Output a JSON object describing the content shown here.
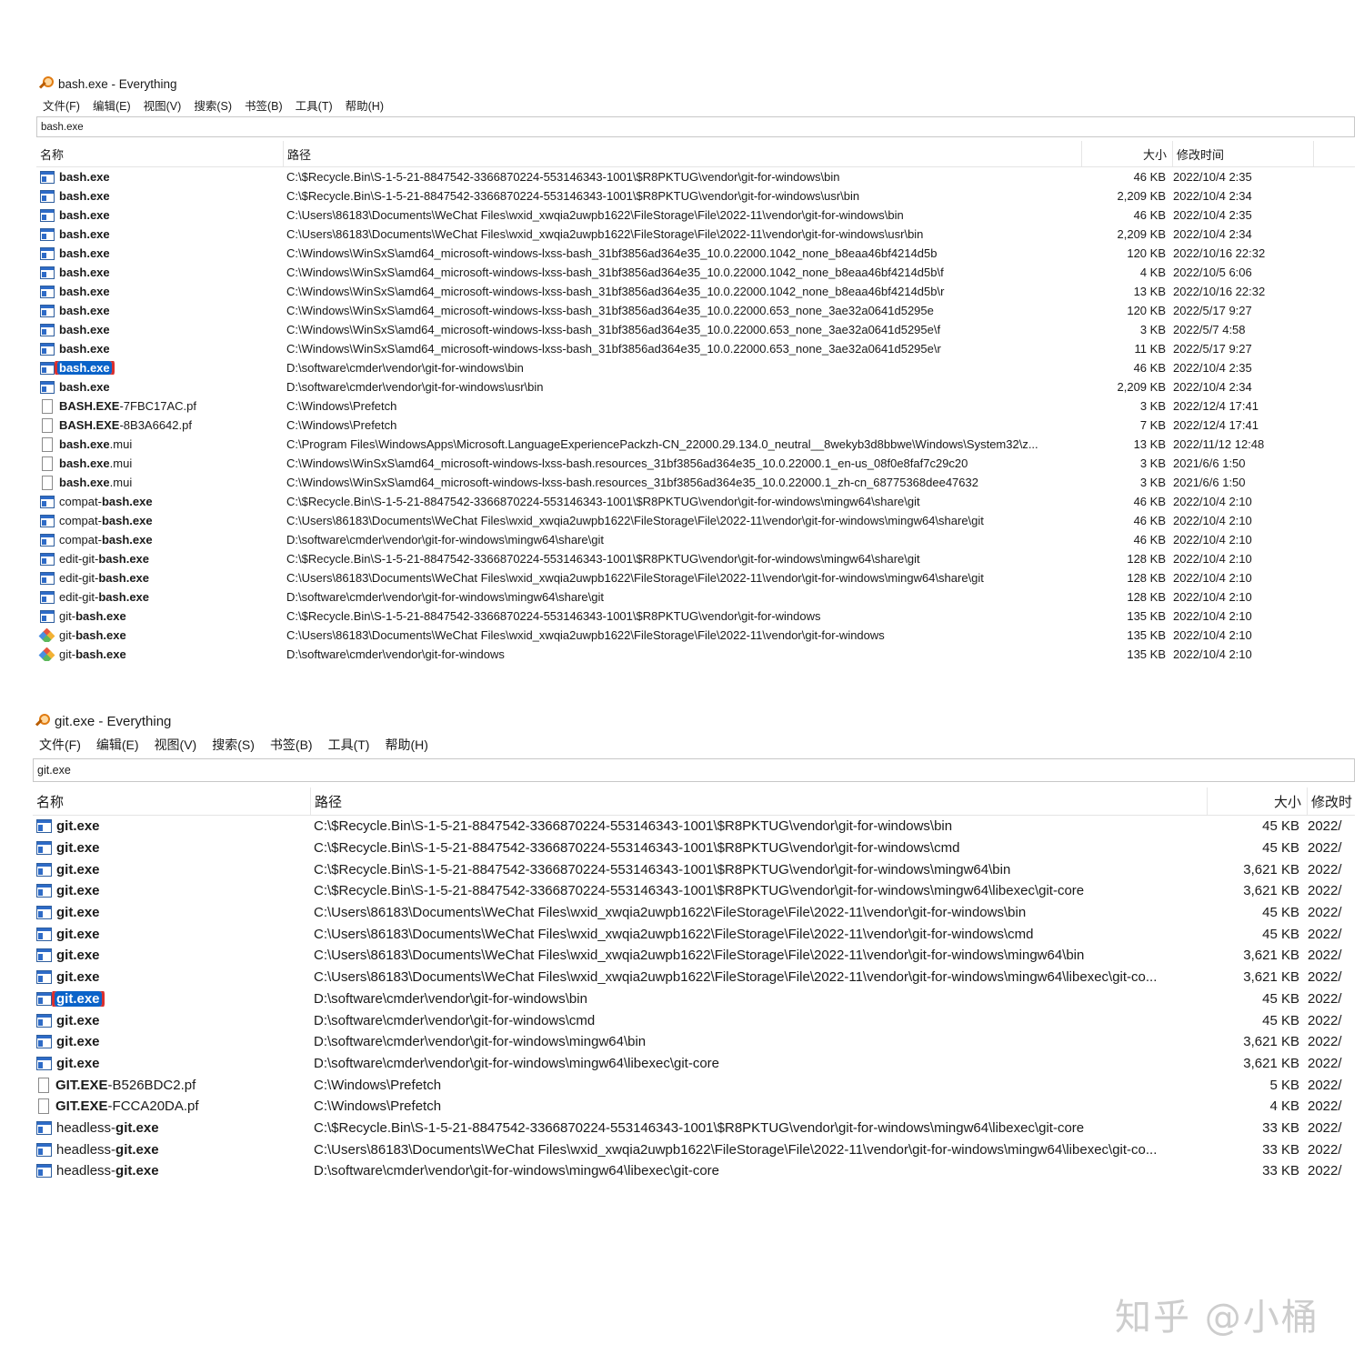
{
  "windows": [
    {
      "title": "bash.exe - Everything",
      "menu": [
        "文件(F)",
        "编辑(E)",
        "视图(V)",
        "搜索(S)",
        "书签(B)",
        "工具(T)",
        "帮助(H)"
      ],
      "search_value": "bash.exe",
      "columns": {
        "name": "名称",
        "path": "路径",
        "size": "大小",
        "modified": "修改时间"
      },
      "selected_index": 10,
      "rows": [
        {
          "icon": "exe-icon",
          "prefix": "",
          "match": "bash.exe",
          "suffix": "",
          "path": "C:\\$Recycle.Bin\\S-1-5-21-8847542-3366870224-553146343-1001\\$R8PKTUG\\vendor\\git-for-windows\\bin",
          "size": "46 KB",
          "modified": "2022/10/4 2:35"
        },
        {
          "icon": "exe-icon",
          "prefix": "",
          "match": "bash.exe",
          "suffix": "",
          "path": "C:\\$Recycle.Bin\\S-1-5-21-8847542-3366870224-553146343-1001\\$R8PKTUG\\vendor\\git-for-windows\\usr\\bin",
          "size": "2,209 KB",
          "modified": "2022/10/4 2:34"
        },
        {
          "icon": "exe-icon",
          "prefix": "",
          "match": "bash.exe",
          "suffix": "",
          "path": "C:\\Users\\86183\\Documents\\WeChat Files\\wxid_xwqia2uwpb1622\\FileStorage\\File\\2022-11\\vendor\\git-for-windows\\bin",
          "size": "46 KB",
          "modified": "2022/10/4 2:35"
        },
        {
          "icon": "exe-icon",
          "prefix": "",
          "match": "bash.exe",
          "suffix": "",
          "path": "C:\\Users\\86183\\Documents\\WeChat Files\\wxid_xwqia2uwpb1622\\FileStorage\\File\\2022-11\\vendor\\git-for-windows\\usr\\bin",
          "size": "2,209 KB",
          "modified": "2022/10/4 2:34"
        },
        {
          "icon": "exe-icon",
          "prefix": "",
          "match": "bash.exe",
          "suffix": "",
          "path": "C:\\Windows\\WinSxS\\amd64_microsoft-windows-lxss-bash_31bf3856ad364e35_10.0.22000.1042_none_b8eaa46bf4214d5b",
          "size": "120 KB",
          "modified": "2022/10/16 22:32"
        },
        {
          "icon": "exe-icon",
          "prefix": "",
          "match": "bash.exe",
          "suffix": "",
          "path": "C:\\Windows\\WinSxS\\amd64_microsoft-windows-lxss-bash_31bf3856ad364e35_10.0.22000.1042_none_b8eaa46bf4214d5b\\f",
          "size": "4 KB",
          "modified": "2022/10/5 6:06"
        },
        {
          "icon": "exe-icon",
          "prefix": "",
          "match": "bash.exe",
          "suffix": "",
          "path": "C:\\Windows\\WinSxS\\amd64_microsoft-windows-lxss-bash_31bf3856ad364e35_10.0.22000.1042_none_b8eaa46bf4214d5b\\r",
          "size": "13 KB",
          "modified": "2022/10/16 22:32"
        },
        {
          "icon": "exe-icon",
          "prefix": "",
          "match": "bash.exe",
          "suffix": "",
          "path": "C:\\Windows\\WinSxS\\amd64_microsoft-windows-lxss-bash_31bf3856ad364e35_10.0.22000.653_none_3ae32a0641d5295e",
          "size": "120 KB",
          "modified": "2022/5/17 9:27"
        },
        {
          "icon": "exe-icon",
          "prefix": "",
          "match": "bash.exe",
          "suffix": "",
          "path": "C:\\Windows\\WinSxS\\amd64_microsoft-windows-lxss-bash_31bf3856ad364e35_10.0.22000.653_none_3ae32a0641d5295e\\f",
          "size": "3 KB",
          "modified": "2022/5/7 4:58"
        },
        {
          "icon": "exe-icon",
          "prefix": "",
          "match": "bash.exe",
          "suffix": "",
          "path": "C:\\Windows\\WinSxS\\amd64_microsoft-windows-lxss-bash_31bf3856ad364e35_10.0.22000.653_none_3ae32a0641d5295e\\r",
          "size": "11 KB",
          "modified": "2022/5/17 9:27"
        },
        {
          "icon": "exe-icon",
          "prefix": "",
          "match": "bash.exe",
          "suffix": "",
          "path": "D:\\software\\cmder\\vendor\\git-for-windows\\bin",
          "size": "46 KB",
          "modified": "2022/10/4 2:35"
        },
        {
          "icon": "exe-icon",
          "prefix": "",
          "match": "bash.exe",
          "suffix": "",
          "path": "D:\\software\\cmder\\vendor\\git-for-windows\\usr\\bin",
          "size": "2,209 KB",
          "modified": "2022/10/4 2:34"
        },
        {
          "icon": "document-icon",
          "prefix": "",
          "match": "BASH.EXE",
          "suffix": "-7FBC17AC.pf",
          "path": "C:\\Windows\\Prefetch",
          "size": "3 KB",
          "modified": "2022/12/4 17:41"
        },
        {
          "icon": "document-icon",
          "prefix": "",
          "match": "BASH.EXE",
          "suffix": "-8B3A6642.pf",
          "path": "C:\\Windows\\Prefetch",
          "size": "7 KB",
          "modified": "2022/12/4 17:41"
        },
        {
          "icon": "document-icon",
          "prefix": "",
          "match": "bash.exe",
          "suffix": ".mui",
          "path": "C:\\Program Files\\WindowsApps\\Microsoft.LanguageExperiencePackzh-CN_22000.29.134.0_neutral__8wekyb3d8bbwe\\Windows\\System32\\z...",
          "size": "13 KB",
          "modified": "2022/11/12 12:48"
        },
        {
          "icon": "document-icon",
          "prefix": "",
          "match": "bash.exe",
          "suffix": ".mui",
          "path": "C:\\Windows\\WinSxS\\amd64_microsoft-windows-lxss-bash.resources_31bf3856ad364e35_10.0.22000.1_en-us_08f0e8faf7c29c20",
          "size": "3 KB",
          "modified": "2021/6/6 1:50"
        },
        {
          "icon": "document-icon",
          "prefix": "",
          "match": "bash.exe",
          "suffix": ".mui",
          "path": "C:\\Windows\\WinSxS\\amd64_microsoft-windows-lxss-bash.resources_31bf3856ad364e35_10.0.22000.1_zh-cn_68775368dee47632",
          "size": "3 KB",
          "modified": "2021/6/6 1:50"
        },
        {
          "icon": "exe-icon",
          "prefix": "compat-",
          "match": "bash.exe",
          "suffix": "",
          "path": "C:\\$Recycle.Bin\\S-1-5-21-8847542-3366870224-553146343-1001\\$R8PKTUG\\vendor\\git-for-windows\\mingw64\\share\\git",
          "size": "46 KB",
          "modified": "2022/10/4 2:10"
        },
        {
          "icon": "exe-icon",
          "prefix": "compat-",
          "match": "bash.exe",
          "suffix": "",
          "path": "C:\\Users\\86183\\Documents\\WeChat Files\\wxid_xwqia2uwpb1622\\FileStorage\\File\\2022-11\\vendor\\git-for-windows\\mingw64\\share\\git",
          "size": "46 KB",
          "modified": "2022/10/4 2:10"
        },
        {
          "icon": "exe-icon",
          "prefix": "compat-",
          "match": "bash.exe",
          "suffix": "",
          "path": "D:\\software\\cmder\\vendor\\git-for-windows\\mingw64\\share\\git",
          "size": "46 KB",
          "modified": "2022/10/4 2:10"
        },
        {
          "icon": "exe-icon",
          "prefix": "edit-git-",
          "match": "bash.exe",
          "suffix": "",
          "path": "C:\\$Recycle.Bin\\S-1-5-21-8847542-3366870224-553146343-1001\\$R8PKTUG\\vendor\\git-for-windows\\mingw64\\share\\git",
          "size": "128 KB",
          "modified": "2022/10/4 2:10"
        },
        {
          "icon": "exe-icon",
          "prefix": "edit-git-",
          "match": "bash.exe",
          "suffix": "",
          "path": "C:\\Users\\86183\\Documents\\WeChat Files\\wxid_xwqia2uwpb1622\\FileStorage\\File\\2022-11\\vendor\\git-for-windows\\mingw64\\share\\git",
          "size": "128 KB",
          "modified": "2022/10/4 2:10"
        },
        {
          "icon": "exe-icon",
          "prefix": "edit-git-",
          "match": "bash.exe",
          "suffix": "",
          "path": "D:\\software\\cmder\\vendor\\git-for-windows\\mingw64\\share\\git",
          "size": "128 KB",
          "modified": "2022/10/4 2:10"
        },
        {
          "icon": "exe-icon",
          "prefix": "git-",
          "match": "bash.exe",
          "suffix": "",
          "path": "C:\\$Recycle.Bin\\S-1-5-21-8847542-3366870224-553146343-1001\\$R8PKTUG\\vendor\\git-for-windows",
          "size": "135 KB",
          "modified": "2022/10/4 2:10"
        },
        {
          "icon": "git-icon",
          "prefix": "git-",
          "match": "bash.exe",
          "suffix": "",
          "path": "C:\\Users\\86183\\Documents\\WeChat Files\\wxid_xwqia2uwpb1622\\FileStorage\\File\\2022-11\\vendor\\git-for-windows",
          "size": "135 KB",
          "modified": "2022/10/4 2:10"
        },
        {
          "icon": "git-icon",
          "prefix": "git-",
          "match": "bash.exe",
          "suffix": "",
          "path": "D:\\software\\cmder\\vendor\\git-for-windows",
          "size": "135 KB",
          "modified": "2022/10/4 2:10"
        }
      ]
    },
    {
      "title": "git.exe - Everything",
      "menu": [
        "文件(F)",
        "编辑(E)",
        "视图(V)",
        "搜索(S)",
        "书签(B)",
        "工具(T)",
        "帮助(H)"
      ],
      "search_value": "git.exe",
      "columns": {
        "name": "名称",
        "path": "路径",
        "size": "大小",
        "modified": "修改时"
      },
      "selected_index": 8,
      "rows": [
        {
          "icon": "exe-icon",
          "prefix": "",
          "match": "git.exe",
          "suffix": "",
          "path": "C:\\$Recycle.Bin\\S-1-5-21-8847542-3366870224-553146343-1001\\$R8PKTUG\\vendor\\git-for-windows\\bin",
          "size": "45 KB",
          "modified": "2022/"
        },
        {
          "icon": "exe-icon",
          "prefix": "",
          "match": "git.exe",
          "suffix": "",
          "path": "C:\\$Recycle.Bin\\S-1-5-21-8847542-3366870224-553146343-1001\\$R8PKTUG\\vendor\\git-for-windows\\cmd",
          "size": "45 KB",
          "modified": "2022/"
        },
        {
          "icon": "exe-icon",
          "prefix": "",
          "match": "git.exe",
          "suffix": "",
          "path": "C:\\$Recycle.Bin\\S-1-5-21-8847542-3366870224-553146343-1001\\$R8PKTUG\\vendor\\git-for-windows\\mingw64\\bin",
          "size": "3,621 KB",
          "modified": "2022/"
        },
        {
          "icon": "exe-icon",
          "prefix": "",
          "match": "git.exe",
          "suffix": "",
          "path": "C:\\$Recycle.Bin\\S-1-5-21-8847542-3366870224-553146343-1001\\$R8PKTUG\\vendor\\git-for-windows\\mingw64\\libexec\\git-core",
          "size": "3,621 KB",
          "modified": "2022/"
        },
        {
          "icon": "exe-icon",
          "prefix": "",
          "match": "git.exe",
          "suffix": "",
          "path": "C:\\Users\\86183\\Documents\\WeChat Files\\wxid_xwqia2uwpb1622\\FileStorage\\File\\2022-11\\vendor\\git-for-windows\\bin",
          "size": "45 KB",
          "modified": "2022/"
        },
        {
          "icon": "exe-icon",
          "prefix": "",
          "match": "git.exe",
          "suffix": "",
          "path": "C:\\Users\\86183\\Documents\\WeChat Files\\wxid_xwqia2uwpb1622\\FileStorage\\File\\2022-11\\vendor\\git-for-windows\\cmd",
          "size": "45 KB",
          "modified": "2022/"
        },
        {
          "icon": "exe-icon",
          "prefix": "",
          "match": "git.exe",
          "suffix": "",
          "path": "C:\\Users\\86183\\Documents\\WeChat Files\\wxid_xwqia2uwpb1622\\FileStorage\\File\\2022-11\\vendor\\git-for-windows\\mingw64\\bin",
          "size": "3,621 KB",
          "modified": "2022/"
        },
        {
          "icon": "exe-icon",
          "prefix": "",
          "match": "git.exe",
          "suffix": "",
          "path": "C:\\Users\\86183\\Documents\\WeChat Files\\wxid_xwqia2uwpb1622\\FileStorage\\File\\2022-11\\vendor\\git-for-windows\\mingw64\\libexec\\git-co...",
          "size": "3,621 KB",
          "modified": "2022/"
        },
        {
          "icon": "exe-icon",
          "prefix": "",
          "match": "git.exe",
          "suffix": "",
          "path": "D:\\software\\cmder\\vendor\\git-for-windows\\bin",
          "size": "45 KB",
          "modified": "2022/"
        },
        {
          "icon": "exe-icon",
          "prefix": "",
          "match": "git.exe",
          "suffix": "",
          "path": "D:\\software\\cmder\\vendor\\git-for-windows\\cmd",
          "size": "45 KB",
          "modified": "2022/"
        },
        {
          "icon": "exe-icon",
          "prefix": "",
          "match": "git.exe",
          "suffix": "",
          "path": "D:\\software\\cmder\\vendor\\git-for-windows\\mingw64\\bin",
          "size": "3,621 KB",
          "modified": "2022/"
        },
        {
          "icon": "exe-icon",
          "prefix": "",
          "match": "git.exe",
          "suffix": "",
          "path": "D:\\software\\cmder\\vendor\\git-for-windows\\mingw64\\libexec\\git-core",
          "size": "3,621 KB",
          "modified": "2022/"
        },
        {
          "icon": "document-icon",
          "prefix": "",
          "match": "GIT.EXE",
          "suffix": "-B526BDC2.pf",
          "path": "C:\\Windows\\Prefetch",
          "size": "5 KB",
          "modified": "2022/"
        },
        {
          "icon": "document-icon",
          "prefix": "",
          "match": "GIT.EXE",
          "suffix": "-FCCA20DA.pf",
          "path": "C:\\Windows\\Prefetch",
          "size": "4 KB",
          "modified": "2022/"
        },
        {
          "icon": "exe-icon",
          "prefix": "headless-",
          "match": "git.exe",
          "suffix": "",
          "path": "C:\\$Recycle.Bin\\S-1-5-21-8847542-3366870224-553146343-1001\\$R8PKTUG\\vendor\\git-for-windows\\mingw64\\libexec\\git-core",
          "size": "33 KB",
          "modified": "2022/"
        },
        {
          "icon": "exe-icon",
          "prefix": "headless-",
          "match": "git.exe",
          "suffix": "",
          "path": "C:\\Users\\86183\\Documents\\WeChat Files\\wxid_xwqia2uwpb1622\\FileStorage\\File\\2022-11\\vendor\\git-for-windows\\mingw64\\libexec\\git-co...",
          "size": "33 KB",
          "modified": "2022/"
        },
        {
          "icon": "exe-icon",
          "prefix": "headless-",
          "match": "git.exe",
          "suffix": "",
          "path": "D:\\software\\cmder\\vendor\\git-for-windows\\mingw64\\libexec\\git-core",
          "size": "33 KB",
          "modified": "2022/"
        }
      ]
    }
  ],
  "watermark": "知乎 @小桶",
  "colors": {
    "selection": "#0a63c9",
    "highlight_outline": "#d9302f"
  }
}
